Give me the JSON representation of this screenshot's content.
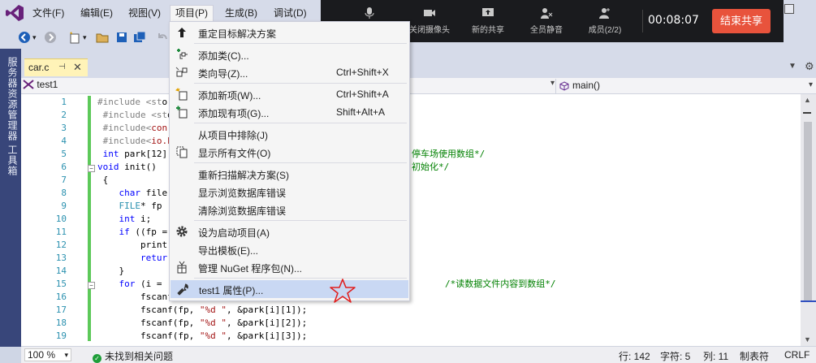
{
  "menubar": {
    "items": [
      "文件(F)",
      "编辑(E)",
      "视图(V)",
      "项目(P)",
      "生成(B)",
      "调试(D)"
    ],
    "active_index": 3
  },
  "meeting_bar": {
    "buttons": [
      "关闭摄像头",
      "新的共享",
      "全员静音",
      "成员(2/2)"
    ],
    "timer": "00:08:07",
    "end_share_label": "结束共享"
  },
  "left_rail": {
    "items": [
      "服务器资源管理器",
      "工具箱"
    ]
  },
  "document_tab": {
    "label": "car.c",
    "pin": "⊣",
    "close": "✕"
  },
  "navbar": {
    "project": "test1",
    "function": "main()"
  },
  "editor": {
    "line_numbers": [
      "1",
      "2",
      "3",
      "4",
      "5",
      "6",
      "7",
      "8",
      "9",
      "10",
      "11",
      "12",
      "13",
      "14",
      "15",
      "16",
      "17",
      "18",
      "19"
    ]
  },
  "project_menu": {
    "items": [
      {
        "label": "重定目标解决方案",
        "shortcut": "",
        "icon": "arrow-up-icon"
      },
      {
        "label": "添加类(C)...",
        "shortcut": "",
        "icon": "add-class-icon"
      },
      {
        "label": "类向导(Z)...",
        "shortcut": "Ctrl+Shift+X",
        "icon": "class-wizard-icon"
      },
      {
        "label": "添加新项(W)...",
        "shortcut": "Ctrl+Shift+A",
        "icon": "add-new-item-icon"
      },
      {
        "label": "添加现有项(G)...",
        "shortcut": "Shift+Alt+A",
        "icon": "add-existing-item-icon"
      },
      {
        "label": "从项目中排除(J)",
        "shortcut": "",
        "icon": ""
      },
      {
        "label": "显示所有文件(O)",
        "shortcut": "",
        "icon": "show-all-files-icon"
      },
      {
        "label": "重新扫描解决方案(S)",
        "shortcut": "",
        "icon": ""
      },
      {
        "label": "显示浏览数据库错误",
        "shortcut": "",
        "icon": ""
      },
      {
        "label": "清除浏览数据库错误",
        "shortcut": "",
        "icon": ""
      },
      {
        "label": "设为启动项目(A)",
        "shortcut": "",
        "icon": "gear-icon"
      },
      {
        "label": "导出模板(E)...",
        "shortcut": "",
        "icon": ""
      },
      {
        "label": "管理 NuGet 程序包(N)...",
        "shortcut": "",
        "icon": "nuget-icon"
      },
      {
        "label": "test1 属性(P)...",
        "shortcut": "",
        "icon": "wrench-icon"
      }
    ]
  },
  "statusbar": {
    "zoom": "100 %",
    "status": "未找到相关问题",
    "line": "行: 142",
    "char": "字符: 5",
    "col": "列: 11",
    "tab": "制表符",
    "eol": "CRLF"
  },
  "colors": {
    "menubar_bg": "#d6dbe9",
    "left_rail": "#38467a",
    "menu_highlight": "#c9d8f3",
    "end_share": "#e8533c",
    "change_bar": "#5dc95a"
  }
}
